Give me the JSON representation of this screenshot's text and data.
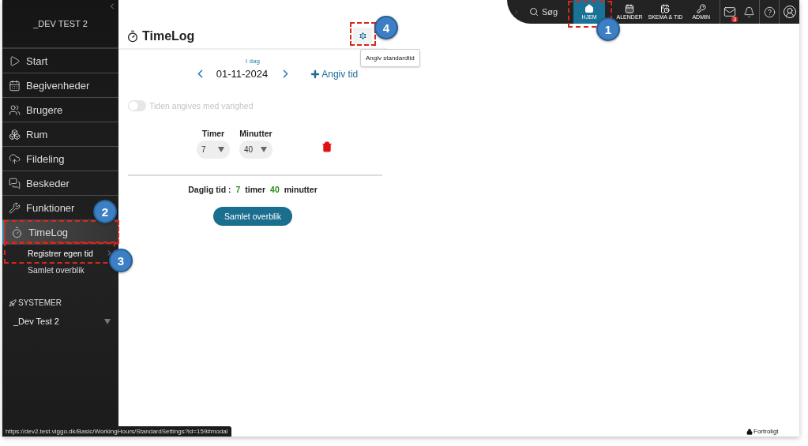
{
  "sidebar": {
    "title": "_DEV TEST 2",
    "items": [
      {
        "label": "Start",
        "selected": false
      },
      {
        "label": "Begivenheder",
        "selected": false
      },
      {
        "label": "Brugere",
        "selected": false
      },
      {
        "label": "Rum",
        "selected": false
      },
      {
        "label": "Fildeling",
        "selected": false
      },
      {
        "label": "Beskeder",
        "selected": false
      },
      {
        "label": "Funktioner",
        "selected": false
      },
      {
        "label": "TimeLog",
        "selected": true,
        "children": [
          {
            "label": "Registrer egen tid",
            "selected": true
          },
          {
            "label": "Samlet overblik",
            "selected": false
          }
        ]
      }
    ],
    "systems": {
      "heading": "SYSTEMER",
      "value": "_Dev Test 2"
    }
  },
  "top_nav": {
    "search": "Søg",
    "items": [
      {
        "label": "HJEM",
        "selected": true
      },
      {
        "label": "ALENDER",
        "selected": false
      },
      {
        "label": "SKEMA & TID",
        "selected": false
      },
      {
        "label": "ADMIN",
        "selected": false
      }
    ],
    "mail_badge": "3"
  },
  "page": {
    "title": "TimeLog",
    "tooltip": "Angiv standardtid",
    "date_nav": {
      "today": "I dag",
      "date": "01-11-2024",
      "add": "Angiv tid"
    },
    "toggle": {
      "label": "Tiden angives med varighed",
      "on": false,
      "disabled": true
    },
    "fields": [
      {
        "label": "Timer",
        "value": "7"
      },
      {
        "label": "Minutter",
        "value": "40"
      }
    ],
    "total": {
      "label": "Daglig tid :",
      "hours": "7",
      "hours_unit": "timer",
      "minutes": "40",
      "minutes_unit": "minutter"
    },
    "button": "Samlet overblik"
  },
  "status_url": "https://dev2.test.viggo.dk/Basic/WorkingHours/StandardSettings?id=159#modal",
  "confidential": "Fortroligt",
  "callouts": [
    "1",
    "2",
    "3",
    "4"
  ]
}
